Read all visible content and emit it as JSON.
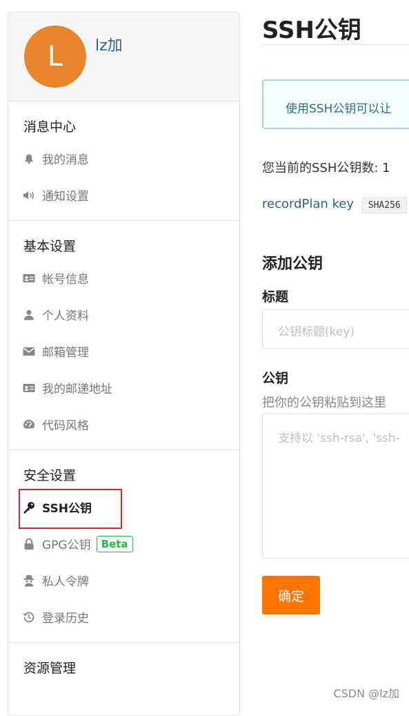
{
  "profile": {
    "avatar_letter": "L",
    "username": "lz加"
  },
  "sidebar": {
    "sections": [
      {
        "title": "消息中心",
        "items": [
          {
            "label": "我的消息",
            "icon": "bell-icon"
          },
          {
            "label": "通知设置",
            "icon": "speaker-icon"
          }
        ]
      },
      {
        "title": "基本设置",
        "items": [
          {
            "label": "帐号信息",
            "icon": "id-card-icon"
          },
          {
            "label": "个人资料",
            "icon": "user-icon"
          },
          {
            "label": "邮箱管理",
            "icon": "envelope-icon"
          },
          {
            "label": "我的邮递地址",
            "icon": "address-card-icon"
          },
          {
            "label": "代码风格",
            "icon": "palette-icon"
          }
        ]
      },
      {
        "title": "安全设置",
        "items": [
          {
            "label": "SSH公钥",
            "icon": "key-icon",
            "active": true
          },
          {
            "label": "GPG公钥",
            "icon": "lock-icon",
            "badge": "Beta"
          },
          {
            "label": "私人令牌",
            "icon": "spy-icon"
          },
          {
            "label": "登录历史",
            "icon": "history-icon"
          }
        ]
      },
      {
        "title": "资源管理"
      }
    ]
  },
  "main": {
    "page_title": "SSH公钥",
    "info_text": "使用SSH公钥可以让",
    "key_count_text": "您当前的SSH公钥数: 1",
    "key_name": "recordPlan key",
    "key_fingerprint": "SHA256",
    "add_title": "添加公钥",
    "title_label": "标题",
    "title_placeholder": "公钥标题(key)",
    "key_label": "公钥",
    "key_hint": "把你的公钥粘贴到这里",
    "key_placeholder": "支持以 'ssh-rsa', 'ssh-",
    "confirm_label": "确定"
  },
  "watermark": "CSDN @lz加",
  "colors": {
    "accent": "#fe7300",
    "avatar": "#e8852b",
    "link": "#2a6496",
    "highlight": "#d9232d"
  }
}
